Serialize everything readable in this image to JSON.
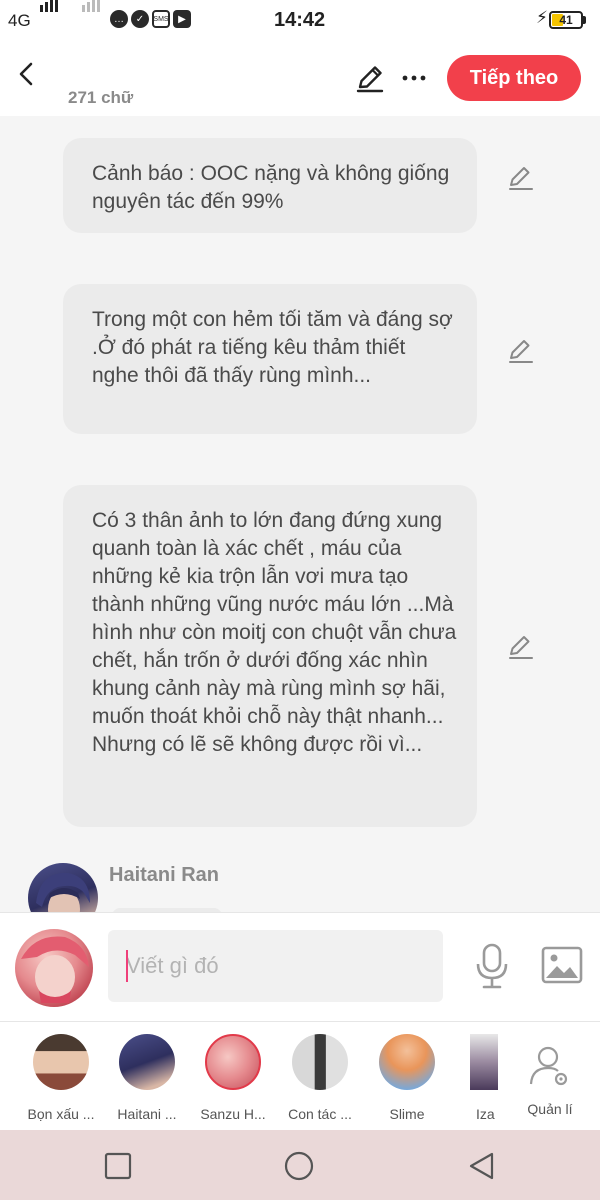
{
  "status_bar": {
    "network": "4G",
    "time": "14:42",
    "battery": "41",
    "battery_level": 0.41,
    "icons": [
      "signal-icon",
      "chat-bubble-icon",
      "check-icon",
      "sms-icon",
      "youtube-icon",
      "charging-icon"
    ]
  },
  "header": {
    "word_count": "271 chữ",
    "next_label": "Tiếp theo",
    "accent_color": "#f2404b"
  },
  "messages": [
    {
      "text": "Cảnh báo : OOC nặng và không giống nguyên tác đến 99%"
    },
    {
      "text": "Trong một con hẻm tối tăm và đáng sợ  .Ở đó phát ra tiếng kêu thảm thiết nghe thôi đã thấy rùng mình..."
    },
    {
      "text": "Có 3 thân ảnh to lớn đang đứng xung quanh toàn là xác chết , máu của những kẻ kia trộn lẫn vơi mưa tạo thành những vũng nước máu lớn ...Mà hình như còn moitj con chuột vẫn chưa chết,  hắn trốn ở dưới đống xác nhìn khung cảnh này mà rùng mình sợ hãi,  muốn thoát khỏi chỗ này thật nhanh... Nhưng có lẽ sẽ không được rồi vì..."
    }
  ],
  "next_speaker": {
    "name": "Haitani Ran"
  },
  "input": {
    "placeholder": "Viết gì đó"
  },
  "characters": [
    {
      "name": "Bọn xấu ..."
    },
    {
      "name": "Haitani ..."
    },
    {
      "name": "Sanzu H..."
    },
    {
      "name": "Con tác ..."
    },
    {
      "name": "Slime"
    },
    {
      "name": "Iza"
    }
  ],
  "manage_label": "Quản lí"
}
